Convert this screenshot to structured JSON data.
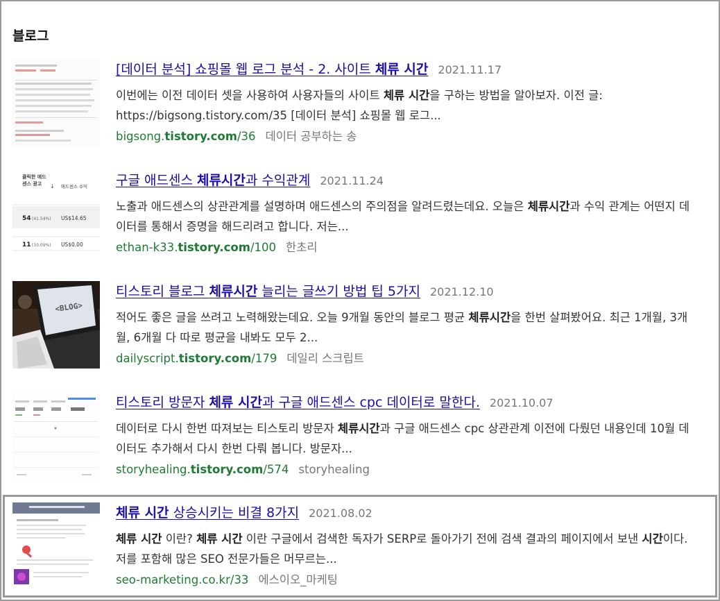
{
  "section": {
    "title": "블로그"
  },
  "results": [
    {
      "title_parts": [
        {
          "t": "[데이터 분석] 쇼핑몰 웹 로그 분석 - 2. 사이트 ",
          "b": false
        },
        {
          "t": "체류 시간",
          "b": true
        }
      ],
      "date": "2021.11.17",
      "snippet_parts": [
        {
          "t": "이번에는 이전 데이터 셋을 사용하여 사용자들의 사이트 ",
          "b": false
        },
        {
          "t": "체류 시간",
          "b": true
        },
        {
          "t": "을 구하는 방법을 알아보자. 이전 글: https://bigsong.tistory.com/35 [데이터 분석] 쇼핑몰 웹 로그...",
          "b": false
        }
      ],
      "url_parts": [
        {
          "t": "bigsong.",
          "b": false
        },
        {
          "t": "tistory.com",
          "b": true
        },
        {
          "t": "/36",
          "b": false
        }
      ],
      "source": "데이터 공부하는 송",
      "thumb": "table-screenshot"
    },
    {
      "title_parts": [
        {
          "t": "구글 애드센스 ",
          "b": false
        },
        {
          "t": "체류시간",
          "b": true
        },
        {
          "t": "과 수익관계",
          "b": false
        }
      ],
      "date": "2021.11.24",
      "snippet_parts": [
        {
          "t": "노출과 애드센스의 상관관계를 설명하며 애드센스의 주의점을 알려드렸는데요. 오늘은 ",
          "b": false
        },
        {
          "t": "체류시간",
          "b": true
        },
        {
          "t": "과 수익 관계는 어떤지 데이터를 통해서 증명을 해드리려고 합니다. 저는...",
          "b": false
        }
      ],
      "url_parts": [
        {
          "t": "ethan-k33.",
          "b": false
        },
        {
          "t": "tistory.com",
          "b": true
        },
        {
          "t": "/100",
          "b": false
        }
      ],
      "source": "한초리",
      "thumb": "adsense-table",
      "thumb_text": {
        "h1": "클릭한 애드",
        "h2": "센스 광고",
        "h3": "애드센스 수익",
        "r1a": "54",
        "r1b": "(41.54%)",
        "r1c": "US$14.65",
        "r2a": "11",
        "r2b": "(10.09%)",
        "r2c": "US$0.00"
      }
    },
    {
      "title_parts": [
        {
          "t": "티스토리 블로그 ",
          "b": false
        },
        {
          "t": "체류시간",
          "b": true
        },
        {
          "t": " 늘리는 글쓰기 방법 팁 5가지",
          "b": false
        }
      ],
      "date": "2021.12.10",
      "snippet_parts": [
        {
          "t": "적어도 좋은 글을 쓰려고 노력해왔는데요. 오늘 9개월 동안의 블로그 평균 ",
          "b": false
        },
        {
          "t": "체류시간",
          "b": true
        },
        {
          "t": "을 한번 살펴봤어요. 최근 1개월, 3개월, 6개월 다 따로 평균을 내봐도 모두 2...",
          "b": false
        }
      ],
      "url_parts": [
        {
          "t": "dailyscript.",
          "b": false
        },
        {
          "t": "tistory.com",
          "b": true
        },
        {
          "t": "/179",
          "b": false
        }
      ],
      "source": "데일리 스크립트",
      "thumb": "laptop-photo",
      "thumb_text": {
        "screen": "<BLOG>"
      }
    },
    {
      "title_parts": [
        {
          "t": "티스토리 방문자 ",
          "b": false
        },
        {
          "t": "체류 시간",
          "b": true
        },
        {
          "t": "과 구글 애드센스 cpc 데이터로 말한다.",
          "b": false
        }
      ],
      "date": "2021.10.07",
      "snippet_parts": [
        {
          "t": "데이터로 다시 한번 따져보는 티스토리 방문자 ",
          "b": false
        },
        {
          "t": "체류시간",
          "b": true
        },
        {
          "t": "과 구글 애드센스 cpc 상관관계 이전에 다뤘던 내용인데 10월 데이터도 추가해서 다시 한번 다뤄 봅니다. 방문자...",
          "b": false
        }
      ],
      "url_parts": [
        {
          "t": "storyhealing.",
          "b": false
        },
        {
          "t": "tistory.com",
          "b": true
        },
        {
          "t": "/574",
          "b": false
        }
      ],
      "source": "storyhealing",
      "thumb": "analytics-screenshot"
    },
    {
      "title_parts": [
        {
          "t": "체류 시간",
          "b": true
        },
        {
          "t": " 상승시키는 비결 8가지",
          "b": false
        }
      ],
      "date": "2021.08.02",
      "snippet_parts": [
        {
          "t": "체류 시간",
          "b": true
        },
        {
          "t": " 이란? ",
          "b": false
        },
        {
          "t": "체류 시간",
          "b": true
        },
        {
          "t": " 이란 구글에서 검색한 독자가 SERP로 돌아가기 전에 검색 결과의 페이지에서 보낸 ",
          "b": false
        },
        {
          "t": "시간",
          "b": true
        },
        {
          "t": "이다. 저를 포함해 많은 SEO 전문가들은 머무르는...",
          "b": false
        }
      ],
      "url_parts": [
        {
          "t": "seo-marketing.co.kr/33",
          "b": false
        }
      ],
      "source": "에스이오_마케팅",
      "thumb": "seo-article",
      "highlighted": true
    }
  ],
  "colors": {
    "link": "#1a0dab",
    "url": "#1e7b34",
    "meta": "#777777",
    "border": "#9a9a9a"
  }
}
